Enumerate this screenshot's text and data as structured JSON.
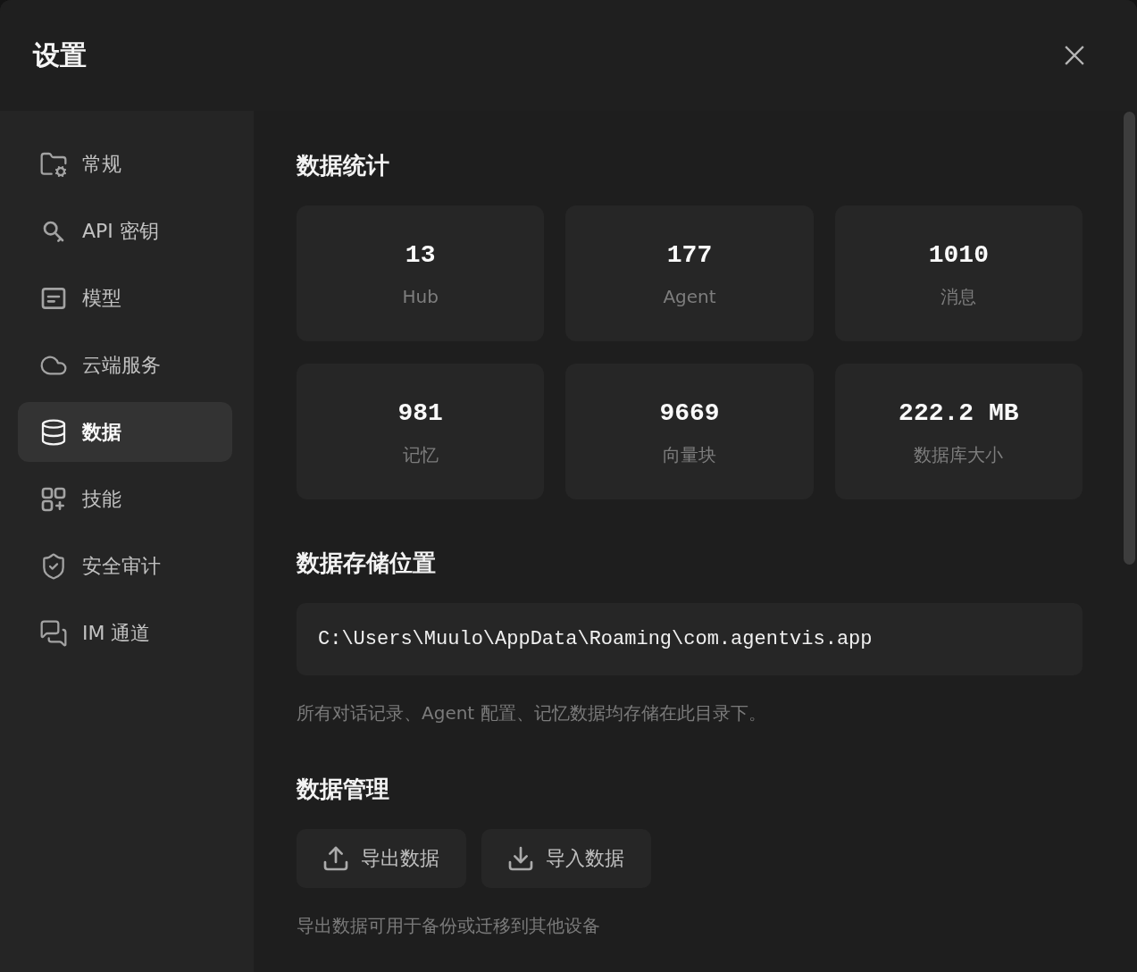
{
  "window": {
    "title": "设置"
  },
  "sidebar": {
    "items": [
      {
        "label": "常规",
        "selected": false
      },
      {
        "label": "API 密钥",
        "selected": false
      },
      {
        "label": "模型",
        "selected": false
      },
      {
        "label": "云端服务",
        "selected": false
      },
      {
        "label": "数据",
        "selected": true
      },
      {
        "label": "技能",
        "selected": false
      },
      {
        "label": "安全审计",
        "selected": false
      },
      {
        "label": "IM 通道",
        "selected": false
      }
    ]
  },
  "statistics": {
    "title": "数据统计",
    "cards": [
      {
        "value": "13",
        "label": "Hub"
      },
      {
        "value": "177",
        "label": "Agent"
      },
      {
        "value": "1010",
        "label": "消息"
      },
      {
        "value": "981",
        "label": "记忆"
      },
      {
        "value": "9669",
        "label": "向量块"
      },
      {
        "value": "222.2 MB",
        "label": "数据库大小"
      }
    ]
  },
  "storage": {
    "title": "数据存储位置",
    "path": "C:\\Users\\Muulo\\AppData\\Roaming\\com.agentvis.app",
    "note": "所有对话记录、Agent 配置、记忆数据均存储在此目录下。"
  },
  "management": {
    "title": "数据管理",
    "buttons": [
      {
        "kind": "export",
        "label": "导出数据"
      },
      {
        "kind": "import",
        "label": "导入数据"
      }
    ],
    "note": "导出数据可用于备份或迁移到其他设备"
  }
}
